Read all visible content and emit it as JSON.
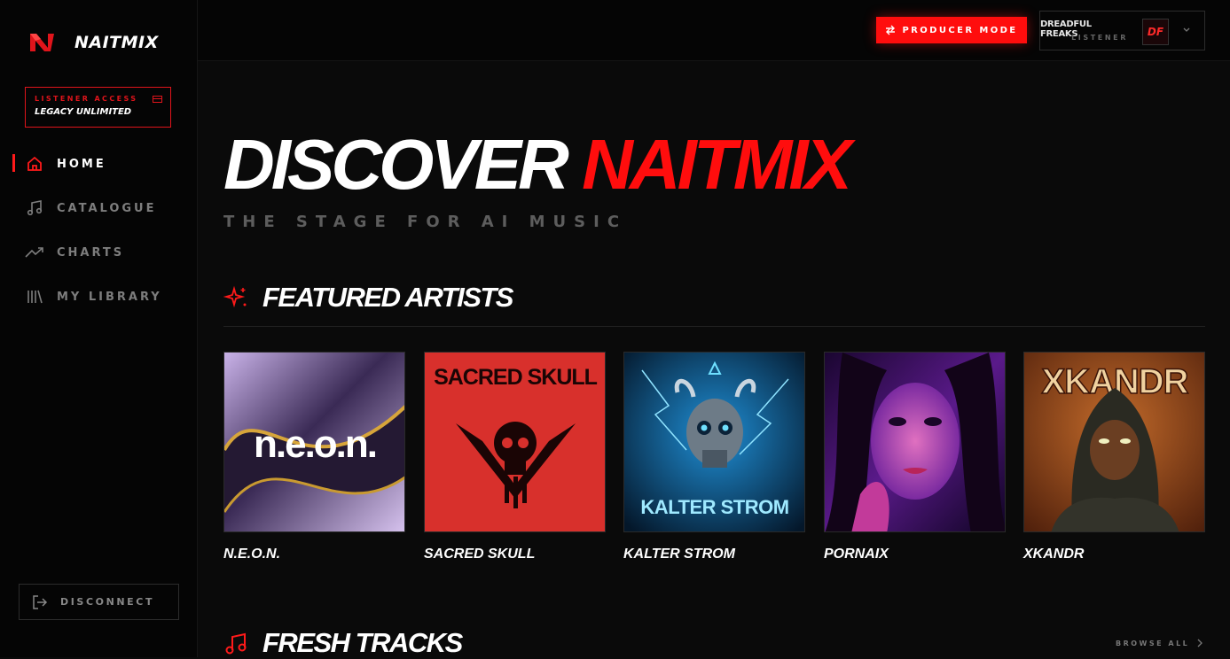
{
  "app": {
    "name": "NAITMIX"
  },
  "access": {
    "label": "LISTENER ACCESS",
    "plan": "LEGACY UNLIMITED"
  },
  "nav": {
    "items": [
      {
        "label": "HOME",
        "icon": "home-icon",
        "active": true
      },
      {
        "label": "CATALOGUE",
        "icon": "music-note-icon"
      },
      {
        "label": "CHARTS",
        "icon": "trending-up-icon"
      },
      {
        "label": "MY LIBRARY",
        "icon": "library-icon"
      }
    ],
    "disconnect": "DISCONNECT"
  },
  "topbar": {
    "producer_mode": "PRODUCER MODE",
    "user": {
      "name": "DREADFUL FREAKS",
      "role": "LISTENER",
      "avatar_text": "DF"
    }
  },
  "hero": {
    "title_white": "DISCOVER",
    "title_red": "NAITMIX",
    "tagline": "THE STAGE FOR AI MUSIC"
  },
  "featured": {
    "title": "FEATURED ARTISTS",
    "artists": [
      {
        "name": "N.E.O.N.",
        "art_text": "n.e.o.n."
      },
      {
        "name": "SACRED SKULL",
        "art_text": "SACRED SKULL"
      },
      {
        "name": "KALTER STROM",
        "art_text": "KALTER STROM"
      },
      {
        "name": "PORNAIX"
      },
      {
        "name": "XKANDR",
        "art_text": "XKANDR"
      }
    ]
  },
  "fresh": {
    "title": "FRESH TRACKS",
    "browse_all": "BROWSE ALL"
  },
  "colors": {
    "accent": "#ff0d0d",
    "background": "#0a0a0a",
    "sidebar": "#050505"
  }
}
